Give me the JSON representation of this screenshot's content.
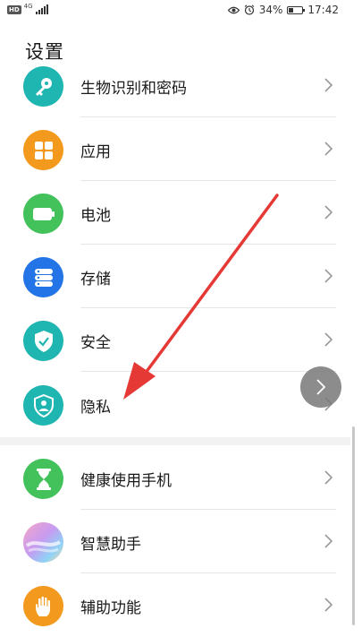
{
  "status_bar": {
    "hd_badge": "HD",
    "network": "4G",
    "battery_percent": "34%",
    "battery_level": 0.34,
    "time": "17:42",
    "icons": [
      "eye-icon",
      "alarm-icon",
      "battery-icon"
    ]
  },
  "page": {
    "title": "设置"
  },
  "settings": {
    "items": [
      {
        "label": "生物识别和密码",
        "icon": "key-icon",
        "color": "#1fb5b0"
      },
      {
        "label": "应用",
        "icon": "apps-grid-icon",
        "color": "#f39a1e"
      },
      {
        "label": "电池",
        "icon": "battery-icon",
        "color": "#43c25b"
      },
      {
        "label": "存储",
        "icon": "storage-icon",
        "color": "#2374e6"
      },
      {
        "label": "安全",
        "icon": "shield-check-icon",
        "color": "#1fb5b0"
      },
      {
        "label": "隐私",
        "icon": "privacy-shield-icon",
        "color": "#1fb5b0"
      },
      {
        "label": "健康使用手机",
        "icon": "hourglass-icon",
        "color": "#43c25b"
      },
      {
        "label": "智慧助手",
        "icon": "assistant-orb-icon",
        "color": "#e89ac6"
      },
      {
        "label": "辅助功能",
        "icon": "hand-icon",
        "color": "#f39a1e"
      }
    ]
  },
  "colors": {
    "annotation_arrow": "#e53935",
    "divider": "#e6e6e6",
    "group_gap": "#f2f2f2"
  }
}
